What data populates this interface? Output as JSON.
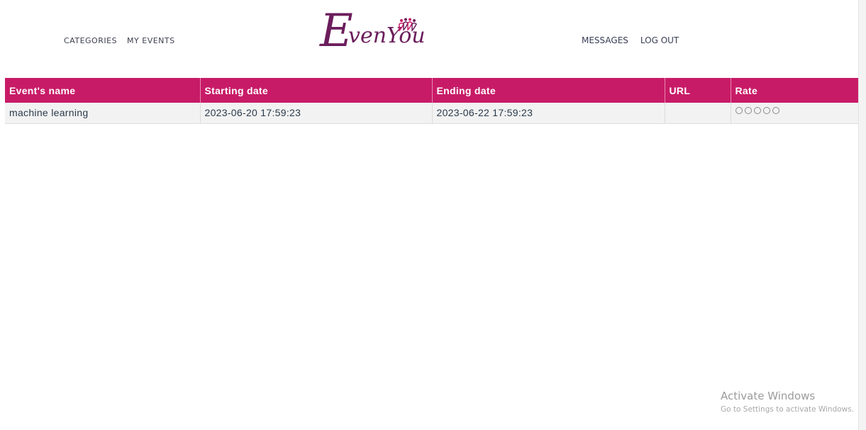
{
  "header": {
    "nav_left": [
      "CATEGORIES",
      "MY EVENTS"
    ],
    "nav_right": [
      "MESSAGES",
      "LOG OUT"
    ],
    "logo": {
      "e_letter": "E",
      "wordmark": "venYou",
      "brand_color": "#6b1d5c",
      "accent_color": "#c81b67"
    }
  },
  "table": {
    "header_color": "#c81b67",
    "columns": [
      "Event's name",
      "Starting date",
      "Ending date",
      "URL",
      "Rate"
    ],
    "rows": [
      {
        "name": "machine learning",
        "start": "2023-06-20 17:59:23",
        "end": "2023-06-22 17:59:23",
        "url": "",
        "rating": 0,
        "rating_max": 5
      }
    ]
  },
  "watermark": {
    "title": "Activate Windows",
    "subtitle": "Go to Settings to activate Windows."
  }
}
